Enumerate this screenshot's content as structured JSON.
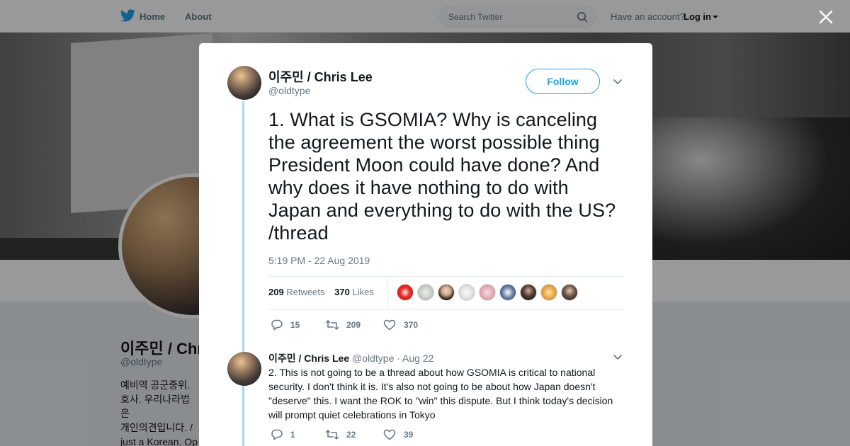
{
  "nav": {
    "home_label": "Home",
    "about_label": "About",
    "search_placeholder": "Search Twitter",
    "account_prompt": "Have an account?",
    "login_label": "Log in"
  },
  "profile": {
    "name": "이주민 / Chris Lee",
    "handle": "@oldtype",
    "bio": "예비역 공군중위. \n호사. 우리나라법은\n개인의견입니다. /\njust a Korean. Op\nnobody else want"
  },
  "tweet": {
    "author_name": "이주민 / Chris Lee",
    "author_handle": "@oldtype",
    "follow_label": "Follow",
    "text": "1. What is GSOMIA? Why is canceling the agreement the worst possible thing President Moon could have done? And why does it have nothing to do with Japan and everything to do with the US? /thread",
    "timestamp": "5:19 PM - 22 Aug 2019",
    "retweets_count": "209",
    "retweets_label": "Retweets",
    "likes_count": "370",
    "likes_label": "Likes",
    "replies": "15",
    "retweets": "209",
    "likes": "370"
  },
  "reply": {
    "author_name": "이주민 / Chris Lee",
    "author_handle": "@oldtype",
    "date": "· Aug 22",
    "text": "2. This is not going to be a thread about how GSOMIA is critical to national security. I don't think it is. It's also not going to be about how Japan doesn't \"deserve\" this. I want the ROK to \"win\" this dispute. But I think today's decision will prompt quiet celebrations in Tokyo",
    "replies": "1",
    "retweets": "22",
    "likes": "39"
  },
  "colors": {
    "accent": "#1da1f2",
    "thread_line": "#a4d9f9",
    "muted": "#657786"
  },
  "icons": {
    "brand": "twitter-bird-icon",
    "search": "search-icon",
    "close": "close-icon",
    "reply": "reply-icon",
    "retweet": "retweet-icon",
    "like": "heart-icon",
    "more": "chevron-down-icon"
  }
}
